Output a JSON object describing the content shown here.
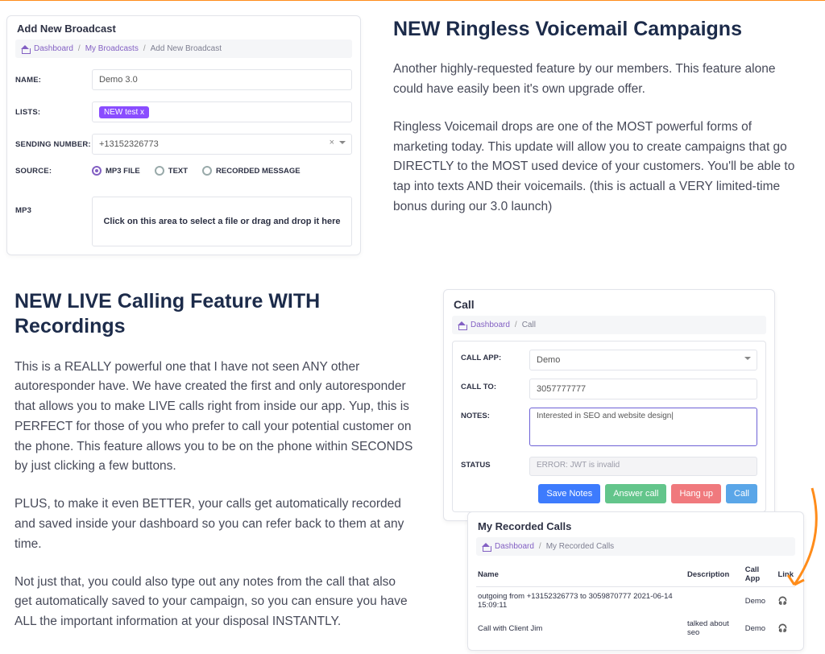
{
  "section1": {
    "headline": "NEW Ringless Voicemail Campaigns",
    "p1": "Another highly-requested feature by our members. This feature alone could have easily been it's own upgrade offer.",
    "p2": "Ringless Voicemail drops are one of the MOST powerful forms of marketing today. This update will allow you to create campaigns that go DIRECTLY to the MOST used device of your customers. You'll be able to tap into texts AND their voicemails. (this is actuall a VERY limited-time bonus during our 3.0 launch)"
  },
  "section2": {
    "headline": "NEW LIVE Calling Feature WITH Recordings",
    "p1": "This is a REALLY powerful one that I have not seen ANY other autoresponder have. We have created the first and only autoresponder that allows you to make LIVE calls right from inside our app. Yup, this is PERFECT for those of you who prefer to call your potential customer on the phone. This feature allows you to be on the phone within SECONDS by just clicking a few buttons.",
    "p2": "PLUS, to make it even BETTER, your calls get automatically recorded and saved inside your dashboard so you can refer back to them at any time.",
    "p3": "Not just that, you could also type out any notes from the call that also get automatically saved to your campaign, so you can ensure you have ALL the important information at your disposal INSTANTLY."
  },
  "broadcast": {
    "title": "Add New Broadcast",
    "breadcrumb": {
      "a": "Dashboard",
      "b": "My Broadcasts",
      "c": "Add New Broadcast"
    },
    "labels": {
      "name": "NAME:",
      "lists": "LISTS:",
      "sending": "SENDING NUMBER:",
      "source": "SOURCE:",
      "mp3": "MP3"
    },
    "name_value": "Demo 3.0",
    "list_chip": "NEW test  x",
    "sending_number": "+13152326773",
    "source_options": {
      "mp3": "MP3 FILE",
      "text": "TEXT",
      "recorded": "RECORDED MESSAGE"
    },
    "dropzone": "Click on this area to select a file or drag and drop it here"
  },
  "call": {
    "title": "Call",
    "breadcrumb": {
      "a": "Dashboard",
      "b": "Call"
    },
    "labels": {
      "app": "CALL APP:",
      "to": "CALL TO:",
      "notes": "NOTES:",
      "status": "STATUS"
    },
    "app_value": "Demo",
    "to_value": "3057777777",
    "notes_value": "Interested in SEO and website design|",
    "status_value": "ERROR: JWT is invalid",
    "buttons": {
      "save": "Save Notes",
      "answer": "Answer call",
      "hangup": "Hang up",
      "call": "Call"
    }
  },
  "recorded": {
    "title": "My Recorded Calls",
    "breadcrumb": {
      "a": "Dashboard",
      "b": "My Recorded Calls"
    },
    "headers": {
      "name": "Name",
      "desc": "Description",
      "app": "Call App",
      "link": "Link"
    },
    "rows": [
      {
        "name": "outgoing from +13152326773 to 3059870777 2021-06-14 15:09:11",
        "desc": "",
        "app": "Demo"
      },
      {
        "name": "Call with Client Jim",
        "desc": "talked about seo",
        "app": "Demo"
      }
    ]
  }
}
